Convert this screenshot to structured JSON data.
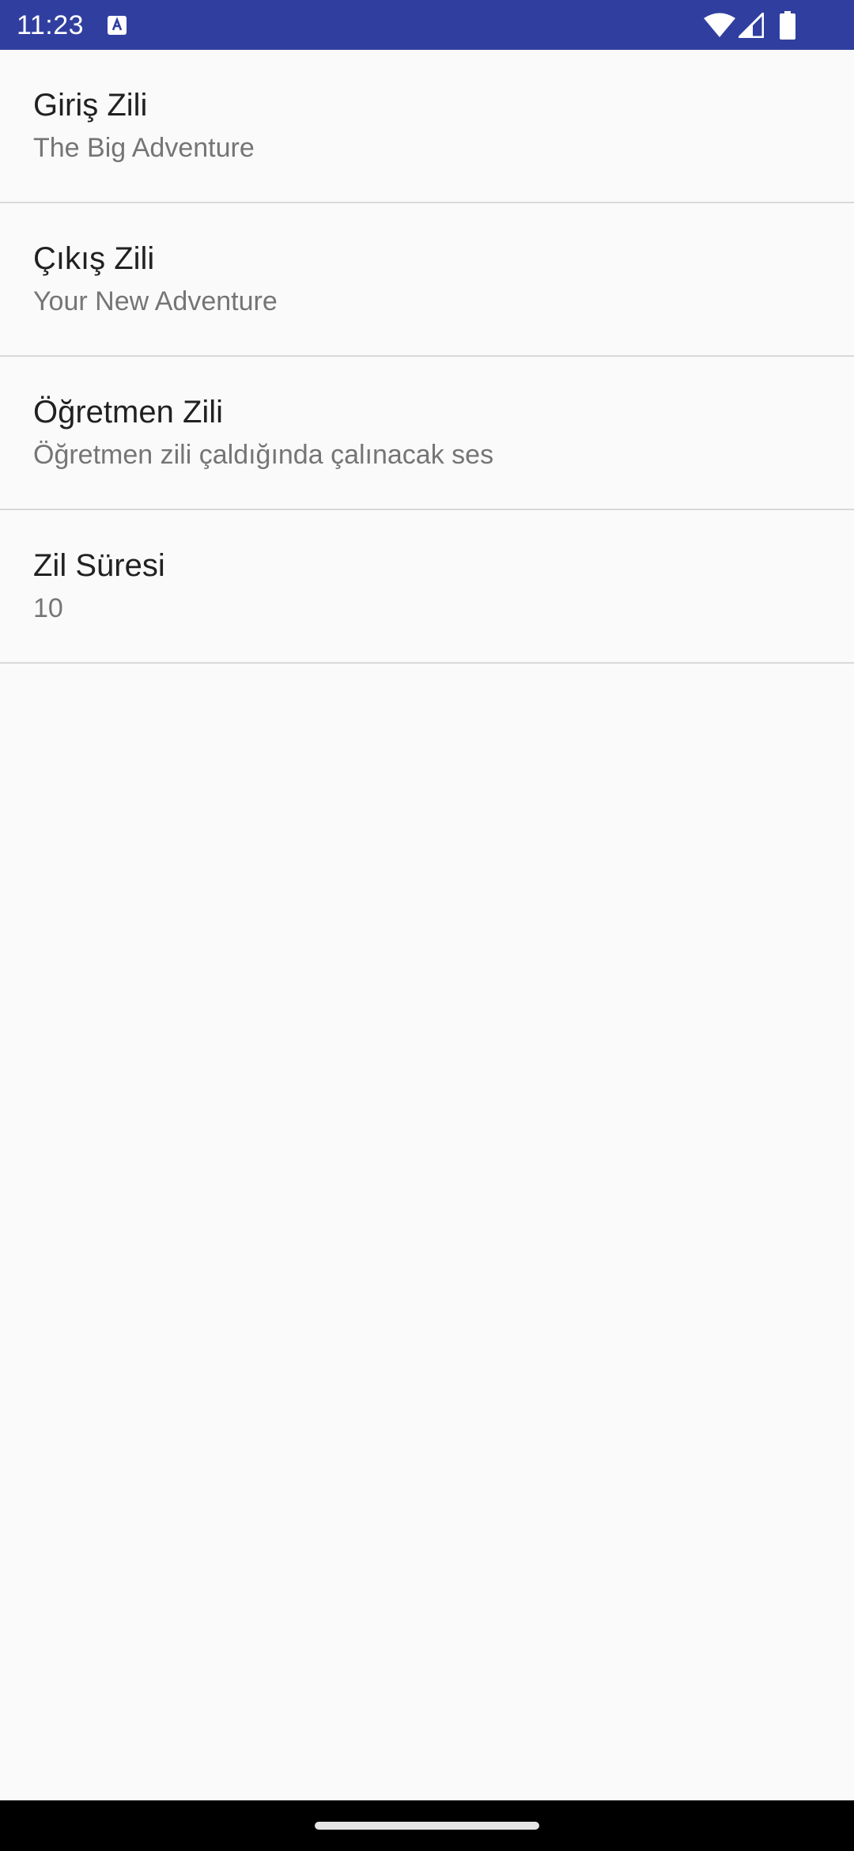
{
  "status_bar": {
    "time": "11:23",
    "background_color": "#303f9f",
    "icons": [
      "notification-a-icon",
      "wifi-icon",
      "signal-icon",
      "battery-icon"
    ]
  },
  "preferences": [
    {
      "title": "Giriş Zili",
      "summary": "The Big Adventure"
    },
    {
      "title": "Çıkış Zili",
      "summary": "Your New Adventure"
    },
    {
      "title": "Öğretmen Zili",
      "summary": "Öğretmen zili çaldığında çalınacak ses"
    },
    {
      "title": "Zil Süresi",
      "summary": "10"
    }
  ],
  "colors": {
    "background": "#fafafa",
    "title_text": "#212121",
    "summary_text": "#757575",
    "divider": "#d9d9d9"
  }
}
